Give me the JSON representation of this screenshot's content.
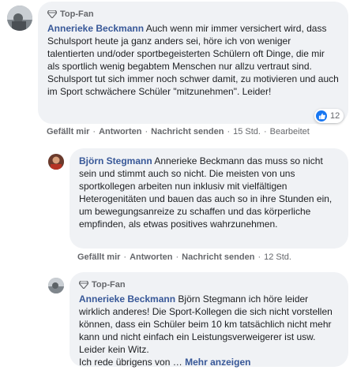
{
  "comments": [
    {
      "badge": "Top-Fan",
      "author": "Annerieke Beckmann",
      "text": "Auch wenn mir immer versichert wird, dass Schulsport heute ja ganz anders sei, höre ich von weniger talentierten und/oder sportbegeisterten Schülern oft Dinge, die mir als sportlich wenig begabtem Menschen nur allzu vertraut sind.\nSchulsport tut sich immer noch schwer damit, zu motivieren und auch im Sport schwächere Schüler \"mitzunehmen\". Leider!",
      "reaction_count": "12",
      "actions": {
        "like": "Gefällt mir",
        "reply": "Antworten",
        "message": "Nachricht senden",
        "time": "15 Std.",
        "edited": "Bearbeitet"
      }
    },
    {
      "author": "Björn Stegmann",
      "text": "Annerieke Beckmann das muss so nicht sein und stimmt auch so nicht. Die meisten von uns sportkollegen arbeiten nun inklusiv mit vielfältigen Heterogenitäten und bauen das auch so in ihre Stunden ein, um bewegungsanreize zu schaffen und das körperliche empfinden, als etwas positives wahrzunehmen.",
      "actions": {
        "like": "Gefällt mir",
        "reply": "Antworten",
        "message": "Nachricht senden",
        "time": "12 Std."
      }
    },
    {
      "badge": "Top-Fan",
      "author": "Annerieke Beckmann",
      "text": "Björn Stegmann ich höre leider wirklich anderes! Die Sport-Kollegen die sich nicht vorstellen können, dass ein Schüler beim 10 km tatsächlich nicht mehr kann und nicht einfach ein Leistungsverweigerer ist usw. Leider kein Witz.\nIch rede übrigens von ",
      "more_ellipsis": "…",
      "more_label": "Mehr anzeigen"
    }
  ]
}
